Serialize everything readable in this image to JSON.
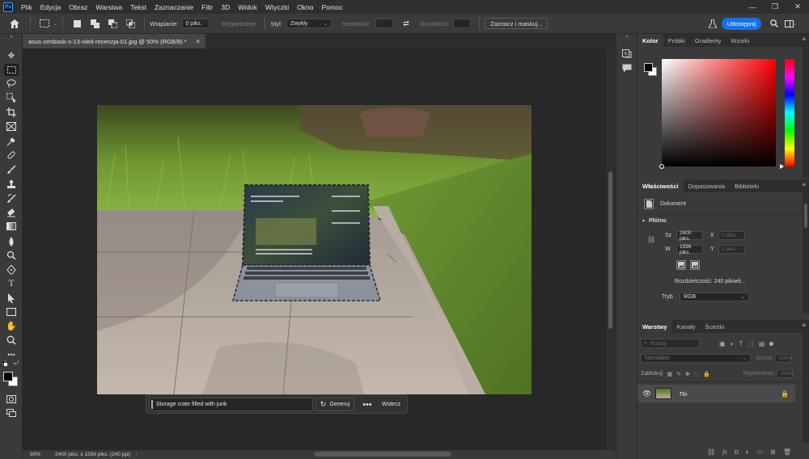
{
  "menu": {
    "items": [
      "Plik",
      "Edycja",
      "Obraz",
      "Warstwa",
      "Tekst",
      "Zaznaczanie",
      "Filtr",
      "3D",
      "Widok",
      "Wtyczki",
      "Okno",
      "Pomoc"
    ]
  },
  "options": {
    "feather_label": "Wtapianie:",
    "feather_value": "0 piks.",
    "smooth_label": "Wygładzanie",
    "style_label": "Styl:",
    "style_value": "Zwykły",
    "width_label": "Szerokość:",
    "height_label": "Wysokość:",
    "select_mask_label": "Zaznacz i maskuj...",
    "share_label": "Udostępnij"
  },
  "document": {
    "tab_title": "asus-zenbook-s-13-oled-recenzja-01.jpg @ 50% (RGB/8) *",
    "zoom": "50%",
    "info": "2400 piks. x 1596 piks. (240 ppi)"
  },
  "taskbar": {
    "prompt": "Storage crate filled with junk",
    "generate_label": "Generuj",
    "more_label": "•••",
    "back_label": "Wstecz"
  },
  "color_panel": {
    "tabs": [
      "Kolor",
      "Próbki",
      "Gradienty",
      "Wzorki"
    ],
    "foreground": "#000000",
    "background": "#ffffff"
  },
  "properties_panel": {
    "tabs": [
      "Właściwości",
      "Dopasowania",
      "Biblioteki"
    ],
    "doc_label": "Dokument",
    "canvas_label": "Płótno",
    "width_label": "Sz",
    "width_value": "2400 piks.",
    "height_label": "W",
    "height_value": "1596 piks.",
    "x_label": "X",
    "x_placeholder": "0 piks.",
    "y_label": "Y",
    "y_placeholder": "0 piks.",
    "resolution": "Rozdzielczość: 240 pikseli...",
    "mode_label": "Tryb",
    "mode_value": "RGB"
  },
  "layers_panel": {
    "tabs": [
      "Warstwy",
      "Kanały",
      "Ścieżki"
    ],
    "search_placeholder": "Rodzaj",
    "blend_mode": "Normalne",
    "opacity_label": "Krycie:",
    "opacity_value": "100%",
    "lock_label": "Zablokuj:",
    "fill_label": "Wypełnienie:",
    "fill_value": "100%",
    "layers": [
      {
        "name": "Tło"
      }
    ]
  },
  "colors": {
    "accent": "#1473e6",
    "panel_bg": "#3a3a3a",
    "canvas_bg": "#282828"
  }
}
